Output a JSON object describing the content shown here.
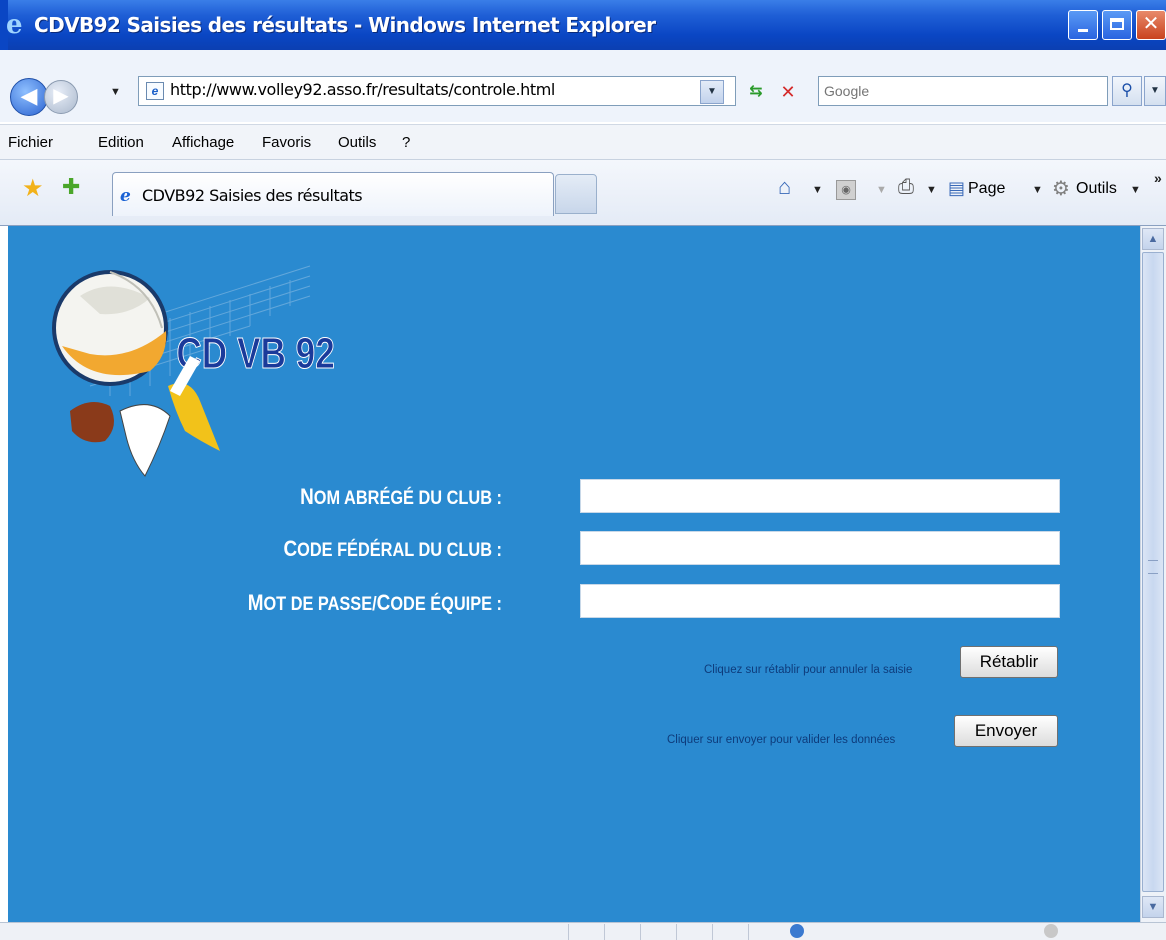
{
  "window": {
    "title": "CDVB92 Saisies des résultats - Windows Internet Explorer"
  },
  "address": {
    "url": "http://www.volley92.asso.fr/resultats/controle.html"
  },
  "search": {
    "placeholder": "Google"
  },
  "menu": {
    "items": [
      "Fichier",
      "Edition",
      "Affichage",
      "Favoris",
      "Outils",
      "?"
    ]
  },
  "tab": {
    "label": "CDVB92 Saisies des résultats"
  },
  "commands": {
    "page": "Page",
    "tools": "Outils"
  },
  "logo": {
    "text": "CD VB 92"
  },
  "form": {
    "fields": [
      {
        "label_first": "N",
        "label_rest": "OM ABRÉGÉ DU CLUB :",
        "value": ""
      },
      {
        "label_first": "C",
        "label_rest": "ODE FÉDÉRAL DU CLUB :",
        "value": ""
      },
      {
        "label_first": "M",
        "label_rest": "OT DE PASSE/",
        "label_first2": "C",
        "label_rest2": "ODE ÉQUIPE :",
        "value": ""
      }
    ],
    "reset_hint": "Cliquez sur rétablir pour annuler la saisie",
    "reset_label": "Rétablir",
    "submit_hint": "Cliquer sur envoyer pour valider les données",
    "submit_label": "Envoyer"
  },
  "colors": {
    "page_background": "#2a8ad0",
    "title_bar": "#0a46c4",
    "hint_text": "#0e3c7c"
  }
}
